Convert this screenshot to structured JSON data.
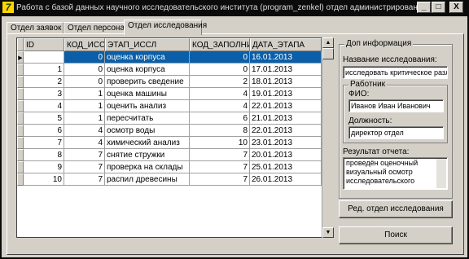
{
  "window": {
    "title": "Работа с базой данных научного исследовательского института (program_zenkel) отдел администрирования",
    "minimize": "_",
    "maximize": "□",
    "close": "X",
    "app_icon_glyph": "7"
  },
  "tabs": [
    {
      "label": "Отдел заявок",
      "active": false
    },
    {
      "label": "Отдел персонала",
      "active": false
    },
    {
      "label": "Отдел исследования",
      "active": true
    }
  ],
  "grid": {
    "columns": [
      "ID",
      "КОД_ИССЛЕ",
      "ЭТАП_ИССЛ",
      "КОД_ЗАПОЛНИКА",
      "ДАТА_ЭТАПА"
    ],
    "rows": [
      {
        "id": "",
        "kod": "0",
        "etap": "оценка корпуса",
        "kod_z": "0",
        "date": "16.01.2013",
        "selected": true
      },
      {
        "id": "1",
        "kod": "0",
        "etap": "оценка корпуса",
        "kod_z": "0",
        "date": "17.01.2013",
        "selected": false
      },
      {
        "id": "2",
        "kod": "0",
        "etap": "проверить сведение",
        "kod_z": "2",
        "date": "18.01.2013",
        "selected": false
      },
      {
        "id": "3",
        "kod": "1",
        "etap": "оценка машины",
        "kod_z": "4",
        "date": "19.01.2013",
        "selected": false
      },
      {
        "id": "4",
        "kod": "1",
        "etap": "оценить анализ",
        "kod_z": "4",
        "date": "22.01.2013",
        "selected": false
      },
      {
        "id": "5",
        "kod": "1",
        "etap": "пересчитать",
        "kod_z": "6",
        "date": "21.01.2013",
        "selected": false
      },
      {
        "id": "6",
        "kod": "4",
        "etap": "осмотр воды",
        "kod_z": "8",
        "date": "22.01.2013",
        "selected": false
      },
      {
        "id": "7",
        "kod": "4",
        "etap": "химический анализ",
        "kod_z": "10",
        "date": "23.01.2013",
        "selected": false
      },
      {
        "id": "8",
        "kod": "7",
        "etap": "снятие стружки",
        "kod_z": "7",
        "date": "20.01.2013",
        "selected": false
      },
      {
        "id": "9",
        "kod": "7",
        "etap": "проверка на склады",
        "kod_z": "7",
        "date": "25.01.2013",
        "selected": false
      },
      {
        "id": "10",
        "kod": "7",
        "etap": "распил древесины",
        "kod_z": "7",
        "date": "26.01.2013",
        "selected": false
      }
    ]
  },
  "info": {
    "group_label": "Доп информация",
    "research_name_label": "Название исследования:",
    "research_name_value": "исследовать критическое разл",
    "worker_group_label": "Работник",
    "fio_label": "ФИО:",
    "fio_value": "Иванов Иван Иванович",
    "position_label": "Должность:",
    "position_value": "директор отдел",
    "result_label": "Результат отчета:",
    "result_value": "проведён оценочный визуальный осмотр исследовательского"
  },
  "buttons": {
    "edit_department": "Ред. отдел исследования",
    "search": "Поиск"
  },
  "colors": {
    "selection": "#0a5fa8",
    "face": "#d4d0c8",
    "titlebar": "#0b0b0b"
  }
}
